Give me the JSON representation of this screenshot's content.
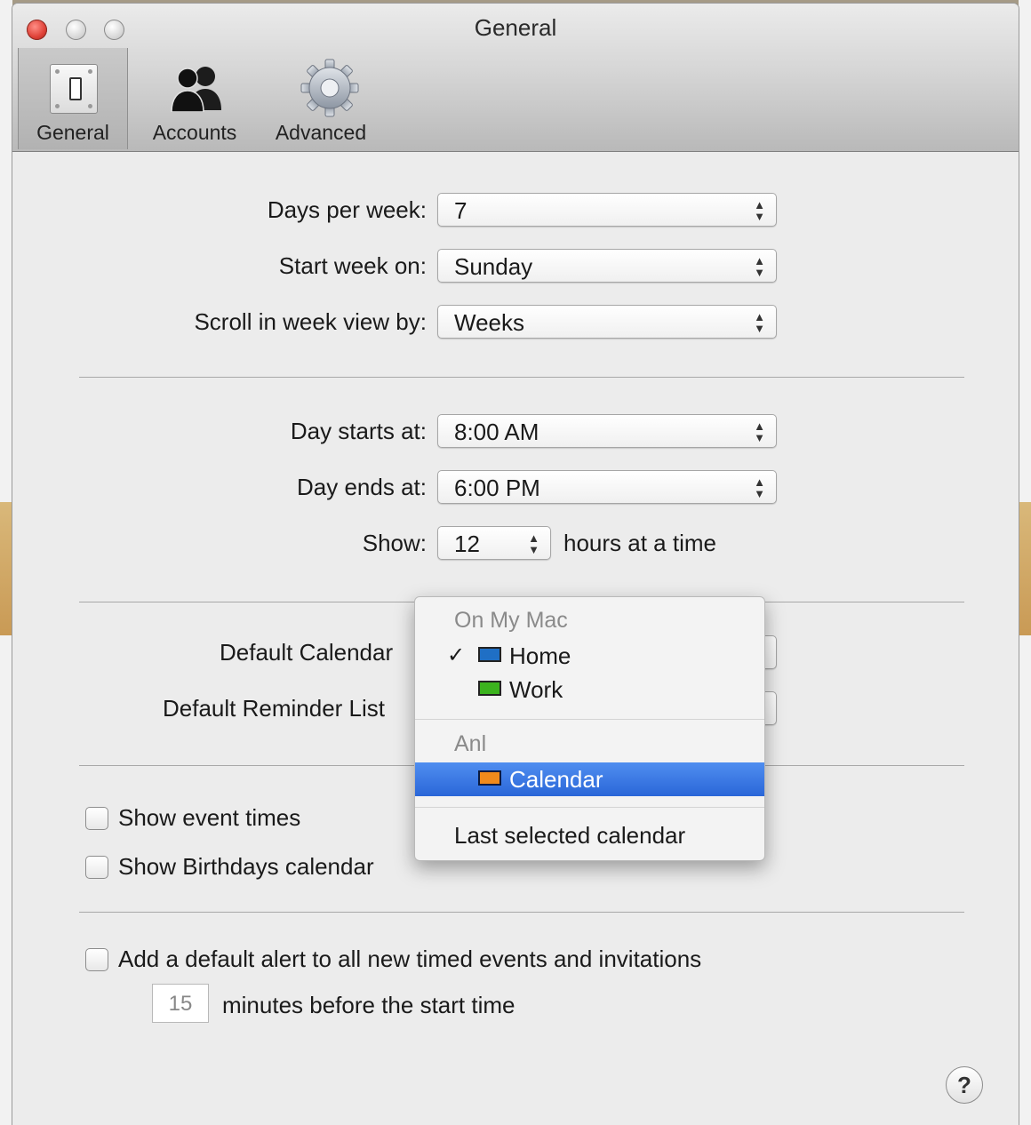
{
  "window": {
    "title": "General"
  },
  "toolbar": {
    "items": [
      {
        "label": "General",
        "selected": true,
        "icon": "switch-icon"
      },
      {
        "label": "Accounts",
        "selected": false,
        "icon": "people-icon"
      },
      {
        "label": "Advanced",
        "selected": false,
        "icon": "gear-icon"
      }
    ]
  },
  "week": {
    "days_per_week_label": "Days per week:",
    "days_per_week_value": "7",
    "start_week_label": "Start week on:",
    "start_week_value": "Sunday",
    "scroll_label": "Scroll in week view by:",
    "scroll_value": "Weeks"
  },
  "day": {
    "starts_label": "Day starts at:",
    "starts_value": "8:00 AM",
    "ends_label": "Day ends at:",
    "ends_value": "6:00 PM",
    "show_label": "Show:",
    "show_value": "12",
    "show_suffix": "hours at a time"
  },
  "defaults": {
    "calendar_label": "Default Calendar",
    "reminder_label": "Default Reminder List"
  },
  "options": {
    "show_event_times": "Show event times",
    "show_birthdays": "Show Birthdays calendar"
  },
  "alert": {
    "label": "Add a default alert to all new timed events and invitations",
    "minutes_value": "15",
    "minutes_suffix": "minutes before the start time"
  },
  "menu": {
    "group1_header": "On My Mac",
    "home": "Home",
    "work": "Work",
    "group2_header": "Anl",
    "calendar": "Calendar",
    "last_selected": "Last selected calendar",
    "colors": {
      "home": "#1f6fc5",
      "work": "#3cb31e",
      "calendar": "#f08a1c"
    }
  },
  "help": {
    "label": "?"
  }
}
